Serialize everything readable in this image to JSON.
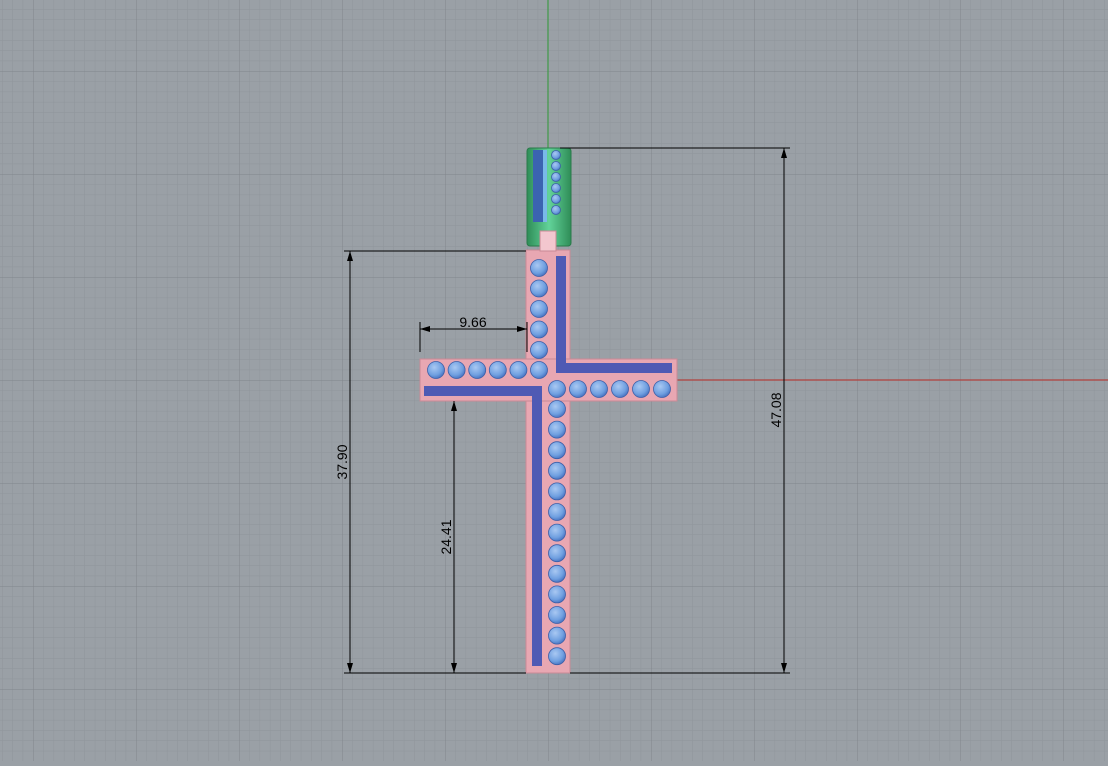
{
  "viewport": {
    "background": "#9aa0a6",
    "grid_minor_color": "#8f959b",
    "grid_major_color": "#80868c",
    "x_axis_color": "#b0413e",
    "y_axis_color": "#3f9a48"
  },
  "model": {
    "metal_color": "#e8a7b2",
    "inlay_color": "#4f5ab4",
    "stone_color": "#6f9fe0",
    "bail_color": "#3ea66a",
    "bail_inlay_color": "#3b63b0"
  },
  "dimensions": {
    "top_arm_width": "9.66",
    "total_height": "47.08",
    "cross_height": "37.90",
    "lower_arm_height": "24.41"
  }
}
